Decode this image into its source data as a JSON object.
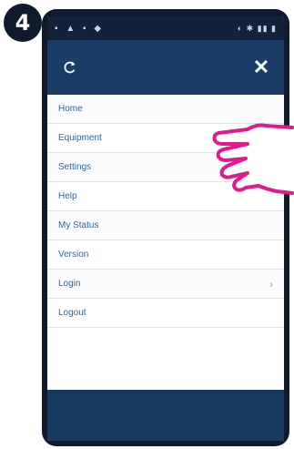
{
  "step_badge": "4",
  "menu": {
    "items": [
      {
        "label": "Home"
      },
      {
        "label": "Equipment"
      },
      {
        "label": "Settings"
      },
      {
        "label": "Help"
      },
      {
        "label": "My Status"
      },
      {
        "label": "Version"
      },
      {
        "label": "Login"
      },
      {
        "label": "Logout"
      }
    ]
  },
  "icons": {
    "back": "refresh-back-icon",
    "close": "close-icon",
    "hand": "pointing-hand-icon",
    "chevron": "chevron-right-icon"
  },
  "colors": {
    "toolbar": "#1a3c66",
    "menu_text": "#2a67a6",
    "hand": "#e01a8c"
  }
}
